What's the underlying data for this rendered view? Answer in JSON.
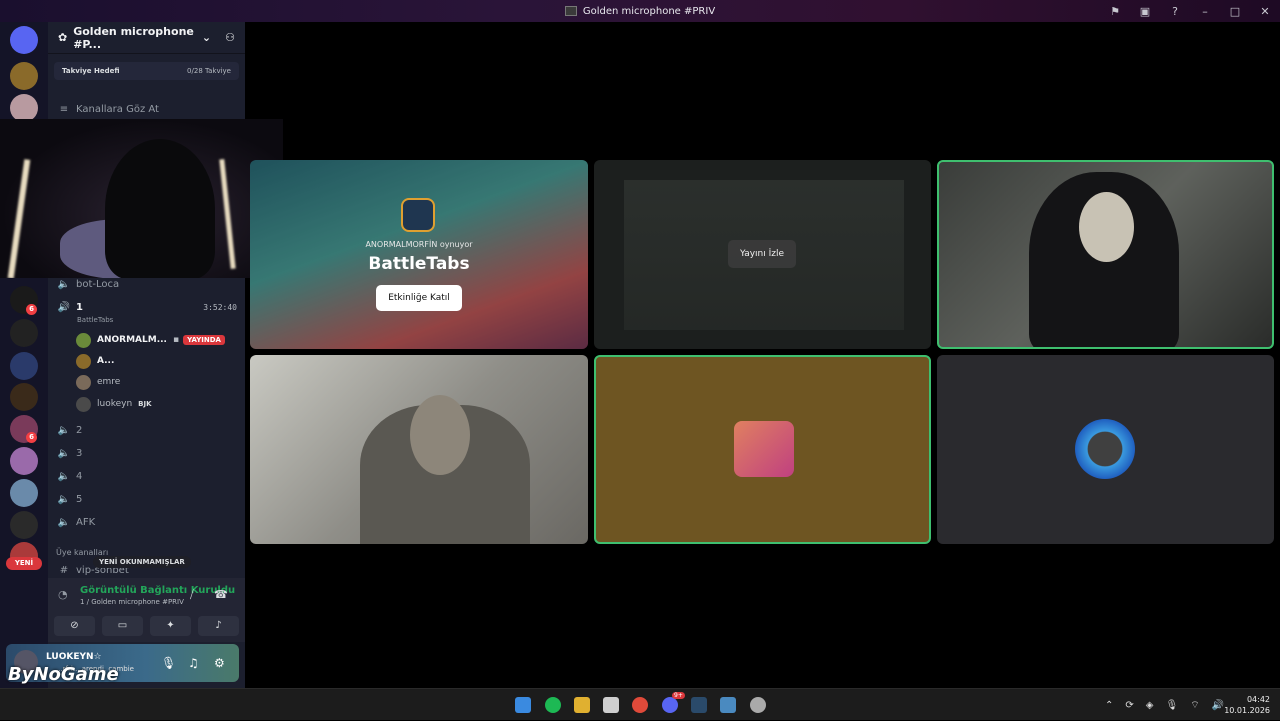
{
  "window": {
    "title": "Golden microphone #PRIV"
  },
  "guild": {
    "name": "Golden microphone #P...",
    "boost_label": "Takviye Hedefi",
    "boost_progress": "0/28 Takviye"
  },
  "nav": {
    "browse_channels": "Kanallara Göz At"
  },
  "channels": {
    "bot_loca": "bot-Loca",
    "vc1": {
      "name": "1",
      "timer": "3:52:40",
      "activity": "BattleTabs"
    },
    "vc2": "2",
    "vc3": "3",
    "vc4": "4",
    "vc5": "5",
    "afk": "AFK",
    "member_channels": "Üye kanalları",
    "vip": "vip-sohbet"
  },
  "voice_users": [
    {
      "name": "ANORMALM...",
      "badge": "YAYINDA"
    },
    {
      "name": "A..."
    },
    {
      "name": "emre"
    },
    {
      "name": "luokeyn",
      "tag": "BJK"
    }
  ],
  "unread_pill": "YENİ OKUNMAMIŞLAR",
  "server_badges": {
    "new": "YENİ",
    "n6": "6",
    "n1": "1"
  },
  "voice_panel": {
    "status": "Görüntülü Bağlantı Kuruldu",
    "location": "1 / Golden microphone #PRIV"
  },
  "user_panel": {
    "name": "LUOKEYN☆",
    "status": "...rfri... arendi, cambie"
  },
  "watermark": "ByNoGame",
  "tiles": {
    "activity": {
      "sub": "ANORMALMORFİN oynuyor",
      "title": "BattleTabs",
      "button": "Etkinliğe Katıl"
    },
    "stream": {
      "button": "Yayını İzle"
    }
  },
  "taskbar": {
    "time": "04:42",
    "date": "10.01.2026",
    "discord_badge": "9+"
  },
  "colors": {
    "accent_green": "#23a55a",
    "live_red": "#da373c",
    "sidebar": "#1c1f2e"
  }
}
